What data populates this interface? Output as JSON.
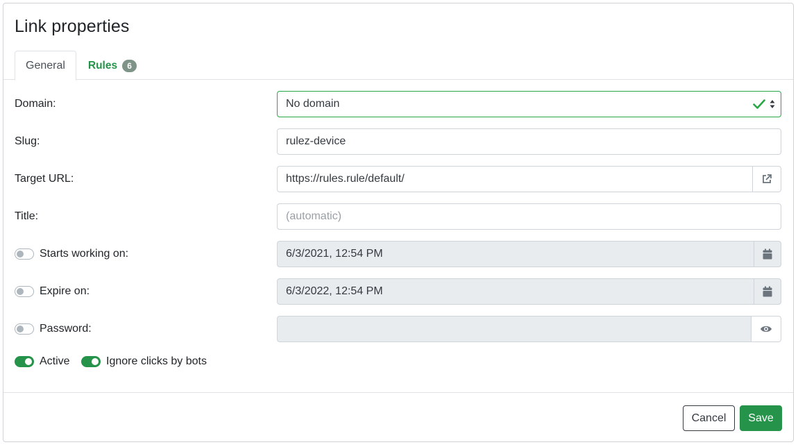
{
  "modal": {
    "title": "Link properties",
    "tabs": [
      {
        "label": "General"
      },
      {
        "label": "Rules",
        "badge": "6"
      }
    ]
  },
  "form": {
    "domain": {
      "label": "Domain:",
      "value": "No domain"
    },
    "slug": {
      "label": "Slug:",
      "value": "rulez-device"
    },
    "target_url": {
      "label": "Target URL:",
      "value": "https://rules.rule/default/"
    },
    "title": {
      "label": "Title:",
      "placeholder": "(automatic)"
    },
    "starts_working_on": {
      "label": "Starts working on:",
      "value": "6/3/2021, 12:54 PM",
      "enabled": false
    },
    "expire_on": {
      "label": "Expire on:",
      "value": "6/3/2022, 12:54 PM",
      "enabled": false
    },
    "password": {
      "label": "Password:",
      "value": "",
      "enabled": false
    },
    "active": {
      "label": "Active",
      "enabled": true
    },
    "ignore_bots": {
      "label": "Ignore clicks by bots",
      "enabled": true
    }
  },
  "footer": {
    "cancel_label": "Cancel",
    "save_label": "Save"
  },
  "icons": {
    "valid": "check-icon",
    "select": "sort-arrows-icon",
    "open_url": "external-link-icon",
    "calendar": "calendar-icon",
    "show_password": "eye-icon"
  },
  "colors": {
    "accent": "#25944a",
    "badge": "#7f9488",
    "disabled_bg": "#e9ecef"
  }
}
